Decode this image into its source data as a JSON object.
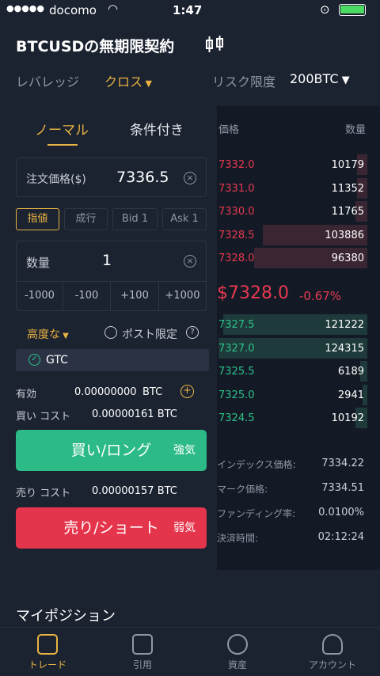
{
  "status": {
    "carrier": "docomo",
    "time": "1:47"
  },
  "header": {
    "title": "BTCUSDの無期限契約",
    "leverage_label": "レバレッジ",
    "margin_mode": "クロス",
    "risk_label": "リスク限度",
    "risk_value": "200BTC"
  },
  "tabs": [
    "ノーマル",
    "条件付き"
  ],
  "order": {
    "price_label": "注文価格($)",
    "price_value": "7336.5",
    "types": [
      "指値",
      "成行",
      "Bid 1",
      "Ask 1"
    ],
    "qty_label": "数量",
    "qty_value": "1",
    "steps": [
      "-1000",
      "-100",
      "+100",
      "+1000"
    ],
    "advanced_label": "高度な",
    "post_only_label": "ポスト限定",
    "tif": "GTC",
    "available_label": "有効",
    "available_value": "0.00000000",
    "available_unit": "BTC",
    "buy_cost_label": "買い コスト",
    "buy_cost_value": "0.00000161 BTC",
    "buy_button": "買い/ロング",
    "buy_tag": "強気",
    "sell_cost_label": "売り コスト",
    "sell_cost_value": "0.00000157 BTC",
    "sell_button": "売り/ショート",
    "sell_tag": "弱気"
  },
  "orderbook": {
    "price_header": "価格",
    "qty_header": "数量",
    "asks": [
      {
        "price": "7332.0",
        "qty": "10179",
        "depth": 0.07
      },
      {
        "price": "7331.0",
        "qty": "11352",
        "depth": 0.07
      },
      {
        "price": "7330.0",
        "qty": "11765",
        "depth": 0.08
      },
      {
        "price": "7328.5",
        "qty": "103886",
        "depth": 0.7
      },
      {
        "price": "7328.0",
        "qty": "96380",
        "depth": 0.76
      }
    ],
    "last_price": "$7328.0",
    "change": "-0.67%",
    "bids": [
      {
        "price": "7327.5",
        "qty": "121222",
        "depth": 0.97
      },
      {
        "price": "7327.0",
        "qty": "124315",
        "depth": 1.0
      },
      {
        "price": "7325.5",
        "qty": "6189",
        "depth": 0.05
      },
      {
        "price": "7325.0",
        "qty": "2941",
        "depth": 0.03
      },
      {
        "price": "7324.5",
        "qty": "10192",
        "depth": 0.08
      }
    ]
  },
  "info": [
    {
      "label": "インデックス価格:",
      "value": "7334.22"
    },
    {
      "label": "マーク価格:",
      "value": "7334.51"
    },
    {
      "label": "ファンディング率:",
      "value": "0.0100%"
    },
    {
      "label": "決済時間:",
      "value": "02:12:24"
    }
  ],
  "positions_title": "マイポジション",
  "nav": [
    "トレード",
    "引用",
    "資産",
    "アカウント"
  ],
  "colors": {
    "accent": "#e8b342",
    "buy": "#2cc28a",
    "sell": "#e63950"
  }
}
